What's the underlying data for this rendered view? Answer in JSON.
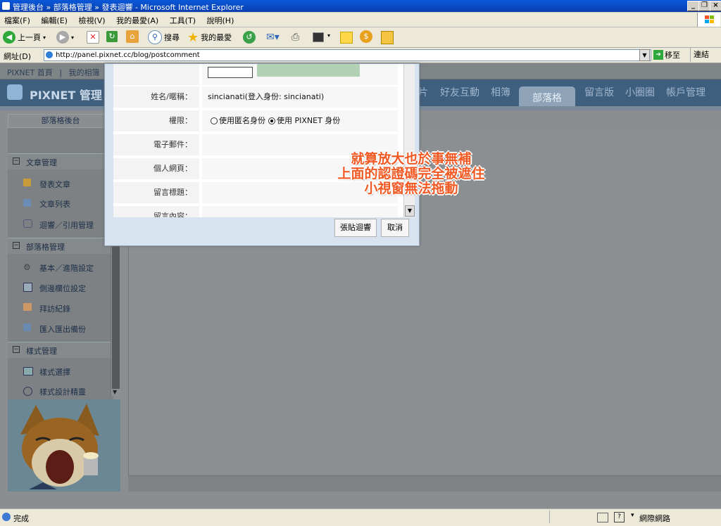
{
  "window": {
    "title": "管理後台 » 部落格管理 » 發表迴響 - Microsoft Internet Explorer"
  },
  "menu": [
    "檔案(F)",
    "編輯(E)",
    "檢視(V)",
    "我的最愛(A)",
    "工具(T)",
    "說明(H)"
  ],
  "toolbar": {
    "back": "上一頁",
    "search": "搜尋",
    "favorites": "我的最愛"
  },
  "address": {
    "label": "網址(D)",
    "url": "http://panel.pixnet.cc/blog/postcomment",
    "go": "移至",
    "links": "連結"
  },
  "site": {
    "toplinks": [
      "PIXNET 首頁",
      "我的相簿"
    ],
    "logo": "PIXNET 管理",
    "nav": [
      "片",
      "好友互動",
      "相簿",
      "部落格",
      "留言版",
      "小圈圈",
      "帳戶管理"
    ],
    "active_nav": "部落格"
  },
  "sidebar": {
    "title": "部落格後台",
    "sections": [
      {
        "title": "文章管理",
        "items": [
          "發表文章",
          "文章列表",
          "迴響／引用管理"
        ]
      },
      {
        "title": "部落格管理",
        "items": [
          "基本／進階設定",
          "側邊欄位設定",
          "拜訪紀錄",
          "匯入匯出備份"
        ]
      },
      {
        "title": "樣式管理",
        "items": [
          "樣式選擇",
          "樣式設計精靈"
        ]
      }
    ]
  },
  "dialog": {
    "fields": [
      {
        "label": "姓名/暱稱：",
        "value": "sincianati(登入身份: sincianati)"
      },
      {
        "label": "權限：",
        "value": ""
      },
      {
        "label": "電子郵件：",
        "value": ""
      },
      {
        "label": "個人網頁：",
        "value": ""
      },
      {
        "label": "留言標題：",
        "value": ""
      },
      {
        "label": "留言內容：",
        "value": ""
      }
    ],
    "radio_anonymous": "使用匿名身份",
    "radio_pixnet": "使用 PIXNET 身份",
    "submit": "張貼迴響",
    "cancel": "取消"
  },
  "overlay": {
    "lines": [
      "就算放大也於事無補",
      "上面的認證碼完全被遮住",
      "小視窗無法拖動"
    ],
    "color": "#f15a24"
  },
  "status": {
    "left": "完成",
    "zone": "網際網路"
  }
}
